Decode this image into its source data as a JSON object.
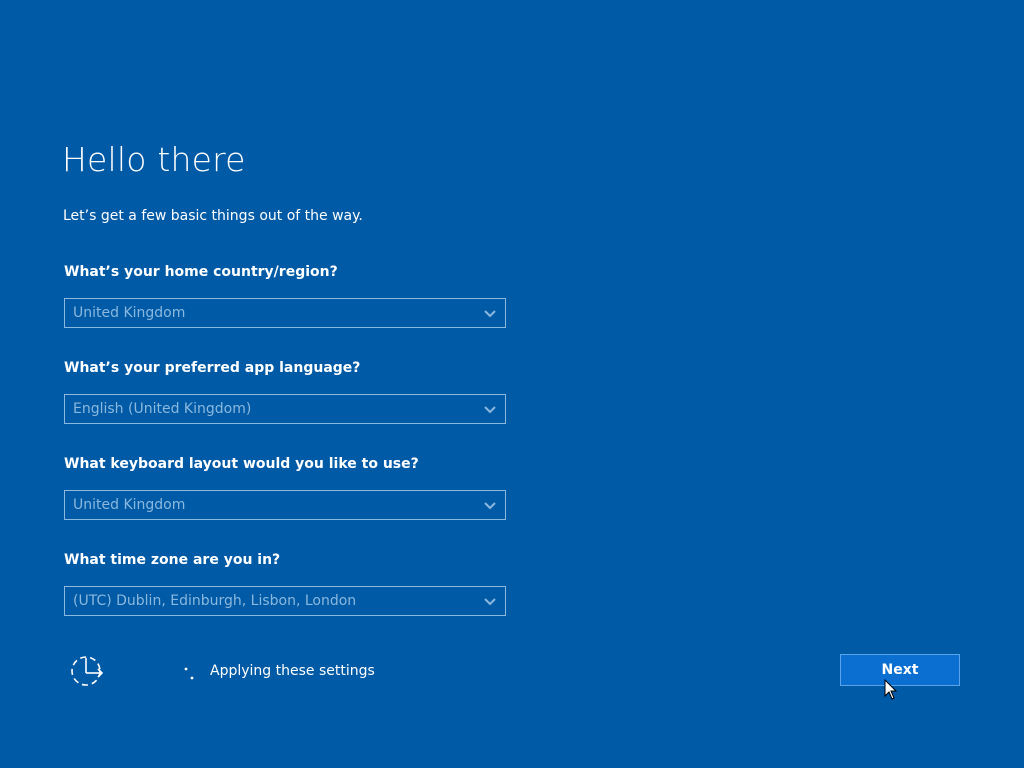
{
  "page": {
    "title": "Hello there",
    "subtitle": "Let’s get a few basic things out of the way."
  },
  "fields": [
    {
      "label": "What’s your home country/region?",
      "value": "United Kingdom"
    },
    {
      "label": "What’s your preferred app language?",
      "value": "English (United Kingdom)"
    },
    {
      "label": "What keyboard layout would you like to use?",
      "value": "United Kingdom"
    },
    {
      "label": "What time zone are you in?",
      "value": "(UTC) Dublin, Edinburgh, Lisbon, London"
    }
  ],
  "footer": {
    "status_text": "Applying these settings",
    "next_label": "Next"
  },
  "icons": {
    "dropdown": "chevron-down-icon",
    "sync": "sync-icon",
    "spinner": "loading-spinner-icon",
    "cursor": "mouse-pointer-icon"
  },
  "colors": {
    "background": "#005aa6",
    "field_border": "#8bb8de",
    "field_text": "#8bb8de",
    "button": "#0a6fd0",
    "text": "#ffffff"
  }
}
